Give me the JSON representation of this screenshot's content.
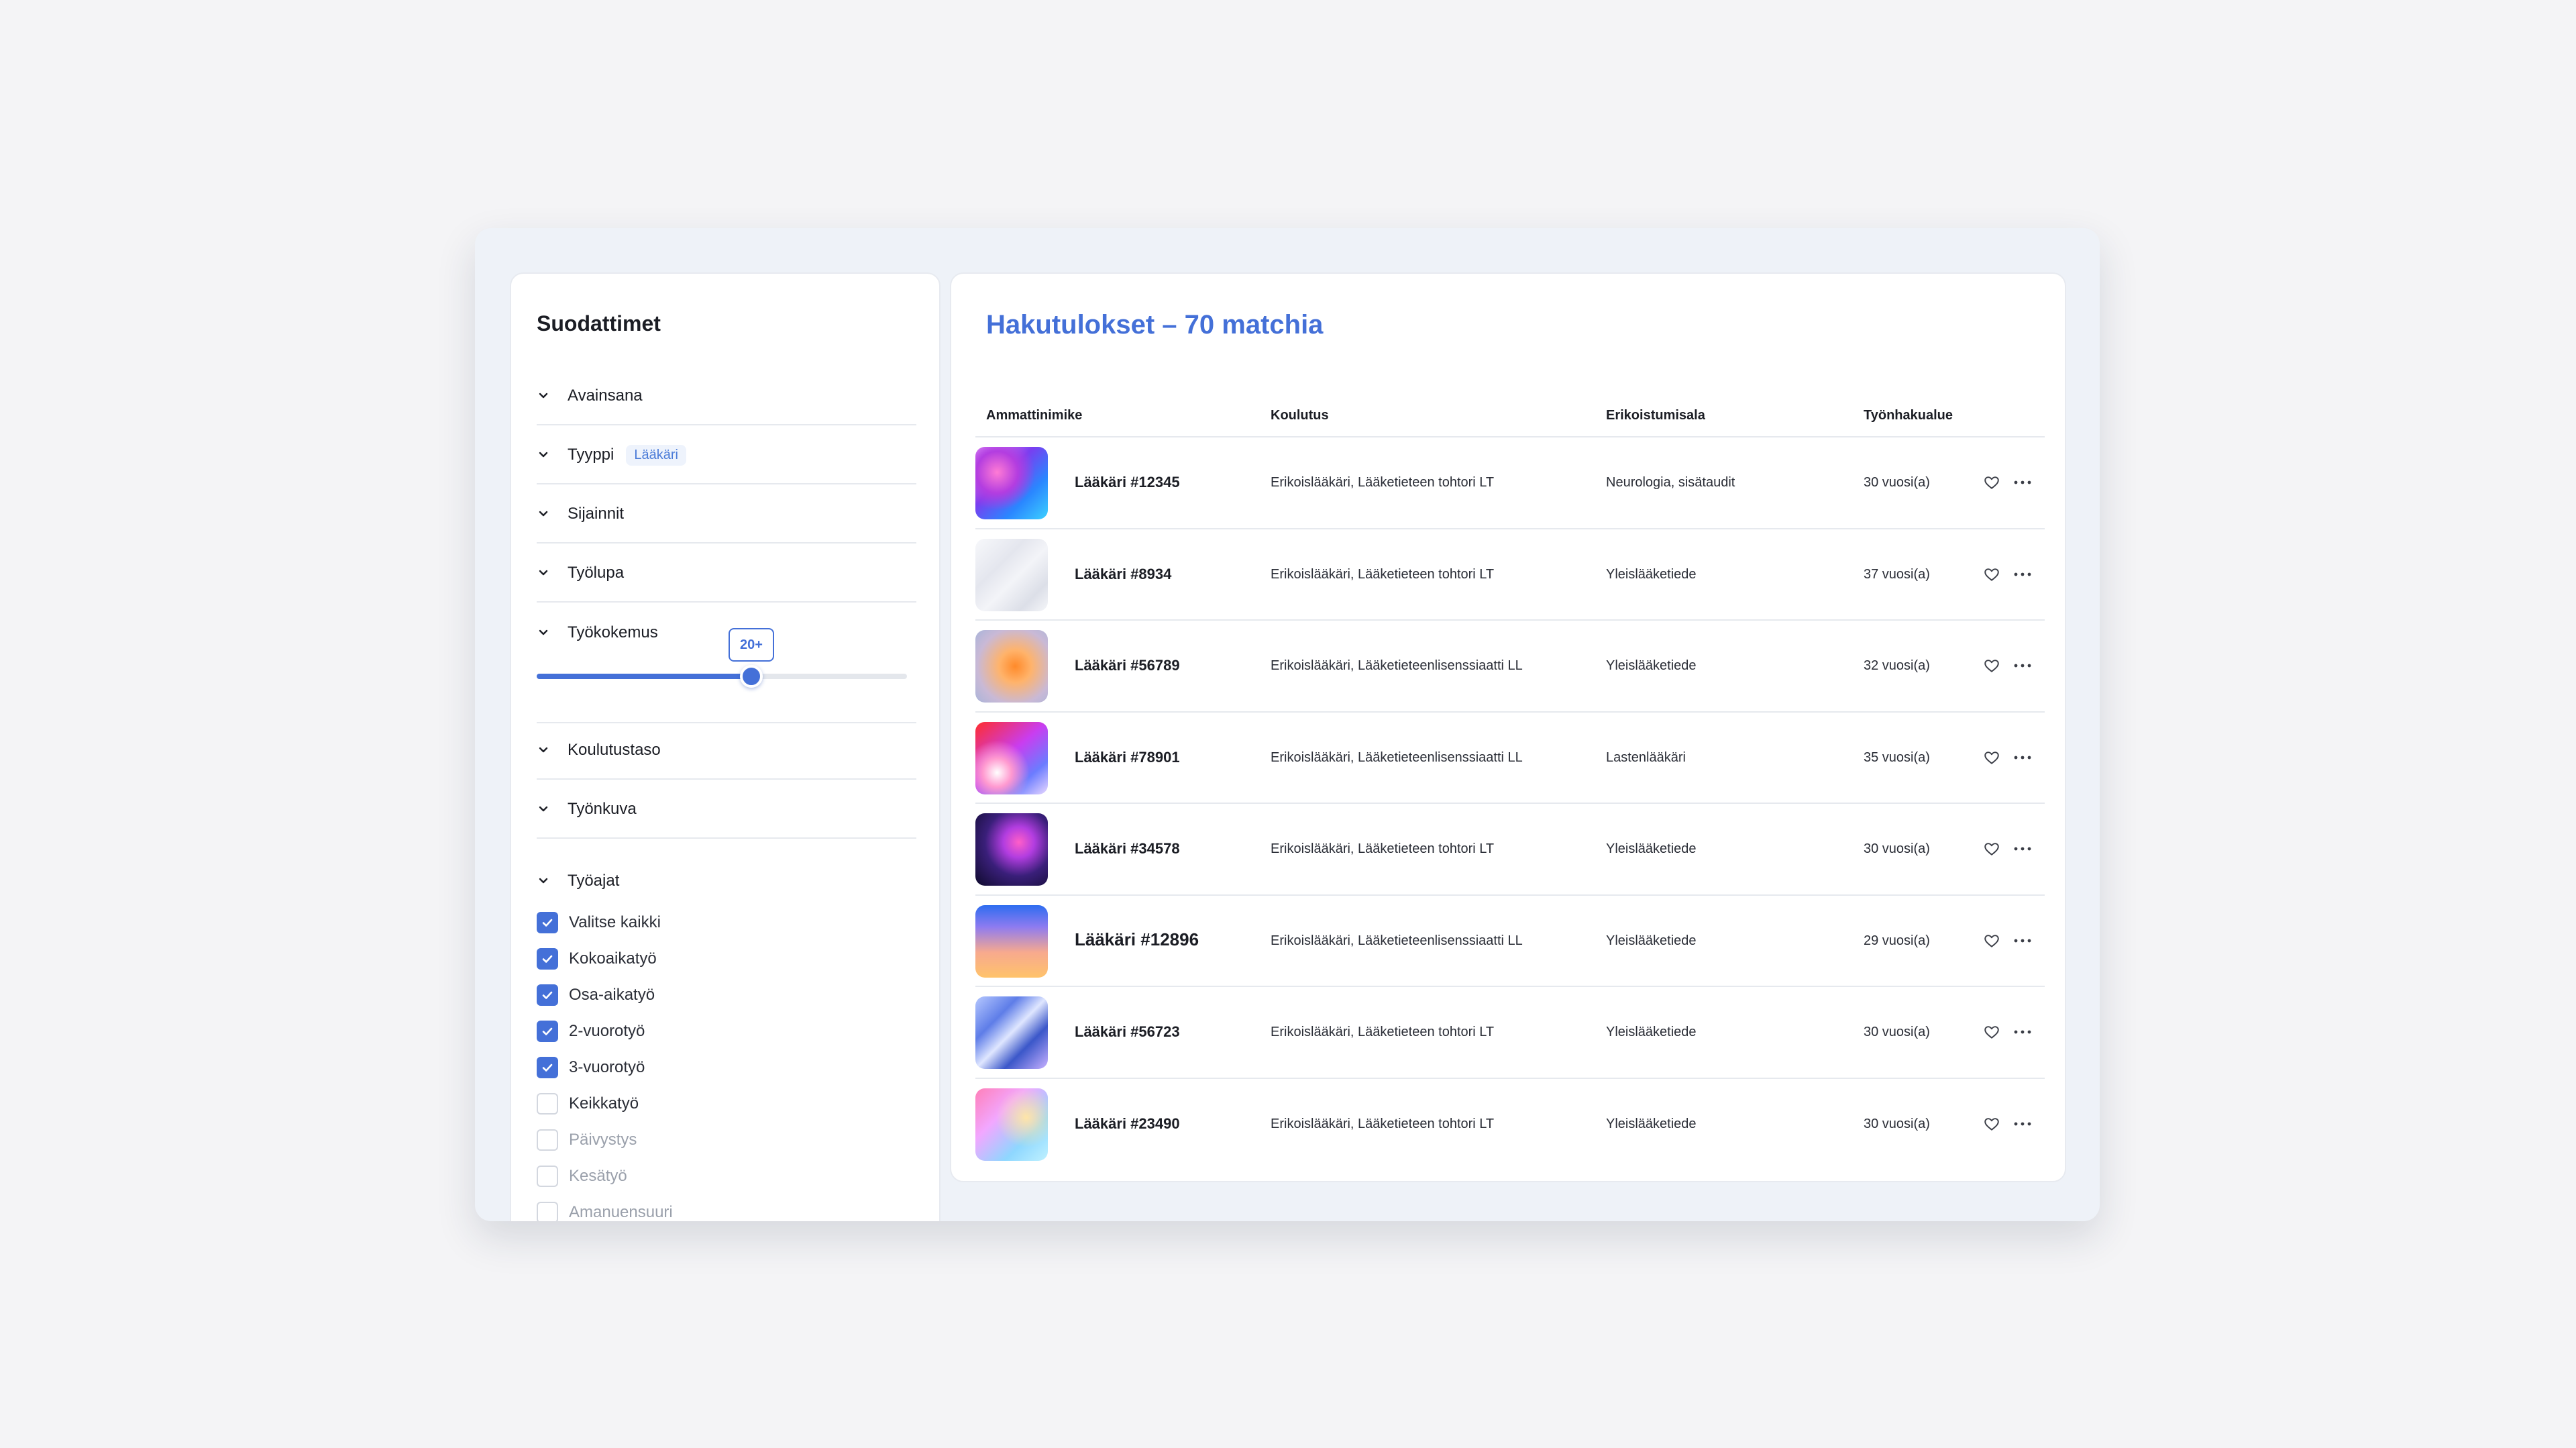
{
  "sidebar": {
    "title": "Suodattimet",
    "filters": [
      {
        "label": "Avainsana"
      },
      {
        "label": "Tyyppi",
        "chip": "Lääkäri"
      },
      {
        "label": "Sijainnit"
      },
      {
        "label": "Työlupa"
      },
      {
        "label": "Työkokemus"
      }
    ],
    "experience_slider": {
      "tooltip": "20+",
      "value_fraction": 0.58
    },
    "filters_after": [
      {
        "label": "Koulutustaso"
      },
      {
        "label": "Työnkuva"
      }
    ],
    "work_times": {
      "label": "Työajat",
      "options": [
        {
          "label": "Valitse kaikki",
          "checked": true
        },
        {
          "label": "Kokoaikatyö",
          "checked": true
        },
        {
          "label": "Osa-aikatyö",
          "checked": true
        },
        {
          "label": "2-vuorotyö",
          "checked": true
        },
        {
          "label": "3-vuorotyö",
          "checked": true
        },
        {
          "label": "Keikkatyö",
          "checked": false
        },
        {
          "label": "Päivystys",
          "checked": false
        },
        {
          "label": "Kesätyö",
          "checked": false
        },
        {
          "label": "Amanuensuuri",
          "checked": false
        }
      ]
    }
  },
  "results": {
    "title": "Hakutulokset – 70 matchia",
    "columns": [
      "Ammattinimike",
      "Koulutus",
      "Erikoistumisala",
      "Työnhakualue"
    ],
    "rows": [
      {
        "name": "Lääkäri #12345",
        "education": "Erikoislääkäri, Lääketieteen tohtori LT",
        "specialty": "Neurologia, sisätaudit",
        "area": "30 vuosi(a)"
      },
      {
        "name": "Lääkäri #8934",
        "education": "Erikoislääkäri, Lääketieteen tohtori LT",
        "specialty": "Yleislääketiede",
        "area": "37 vuosi(a)"
      },
      {
        "name": "Lääkäri #56789",
        "education": "Erikoislääkäri, Lääketieteenlisenssiaatti LL",
        "specialty": "Yleislääketiede",
        "area": "32 vuosi(a)"
      },
      {
        "name": "Lääkäri #78901",
        "education": "Erikoislääkäri, Lääketieteenlisenssiaatti LL",
        "specialty": "Lastenlääkäri",
        "area": "35 vuosi(a)"
      },
      {
        "name": "Lääkäri #34578",
        "education": "Erikoislääkäri, Lääketieteen tohtori LT",
        "specialty": "Yleislääketiede",
        "area": "30 vuosi(a)"
      },
      {
        "name": "Lääkäri #12896",
        "education": "Erikoislääkäri, Lääketieteenlisenssiaatti LL",
        "specialty": "Yleislääketiede",
        "area": "29 vuosi(a)"
      },
      {
        "name": "Lääkäri #56723",
        "education": "Erikoislääkäri, Lääketieteen tohtori LT",
        "specialty": "Yleislääketiede",
        "area": "30 vuosi(a)"
      },
      {
        "name": "Lääkäri #23490",
        "education": "Erikoislääkäri, Lääketieteen tohtori LT",
        "specialty": "Yleislääketiede",
        "area": "30 vuosi(a)"
      }
    ]
  },
  "colors": {
    "accent": "#4470d8",
    "background": "#f4f4f6",
    "panel": "#ffffff",
    "muted": "#9aa0ab"
  },
  "icons": {
    "chevron": "chevron-down-icon",
    "check": "check-icon",
    "favorite": "heart-icon",
    "more": "more-horizontal-icon"
  }
}
